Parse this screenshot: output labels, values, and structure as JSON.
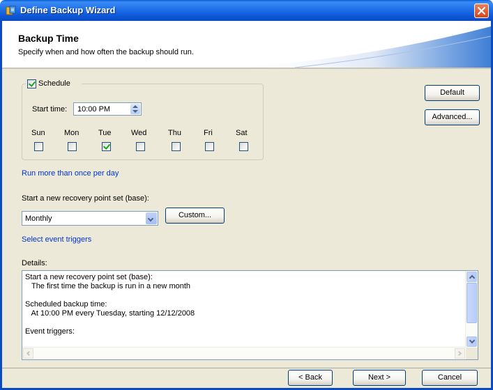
{
  "window": {
    "title": "Define Backup Wizard",
    "icon": "backup-wizard-icon",
    "close_icon": "close-icon"
  },
  "header": {
    "title": "Backup Time",
    "subtitle": "Specify when and how often the backup should run."
  },
  "schedule": {
    "label": "Schedule",
    "checked": true,
    "start_time_label": "Start time:",
    "start_time_value": "10:00 PM",
    "days": [
      {
        "label": "Sun",
        "checked": false
      },
      {
        "label": "Mon",
        "checked": false
      },
      {
        "label": "Tue",
        "checked": true
      },
      {
        "label": "Wed",
        "checked": false
      },
      {
        "label": "Thu",
        "checked": false
      },
      {
        "label": "Fri",
        "checked": false
      },
      {
        "label": "Sat",
        "checked": false
      }
    ]
  },
  "side_buttons": {
    "default_label": "Default",
    "advanced_label": "Advanced..."
  },
  "links": {
    "run_more": "Run more than once per day",
    "event_triggers": "Select event triggers"
  },
  "recovery": {
    "label": "Start a new recovery point set (base):",
    "selected": "Monthly",
    "custom_label": "Custom..."
  },
  "details": {
    "label": "Details:",
    "lines": [
      "Start a new recovery point set (base):",
      "   The first time the backup is run in a new month",
      "",
      "Scheduled backup time:",
      "   At 10:00 PM every Tuesday, starting 12/12/2008",
      "",
      "Event triggers:"
    ]
  },
  "footer": {
    "back_label": "< Back",
    "next_label": "Next >",
    "cancel_label": "Cancel"
  },
  "colors": {
    "titlebar": "#0a5fd8",
    "dialog_bg": "#ece9d8",
    "link": "#0033cc",
    "header_wave": "#3f7fd6"
  }
}
